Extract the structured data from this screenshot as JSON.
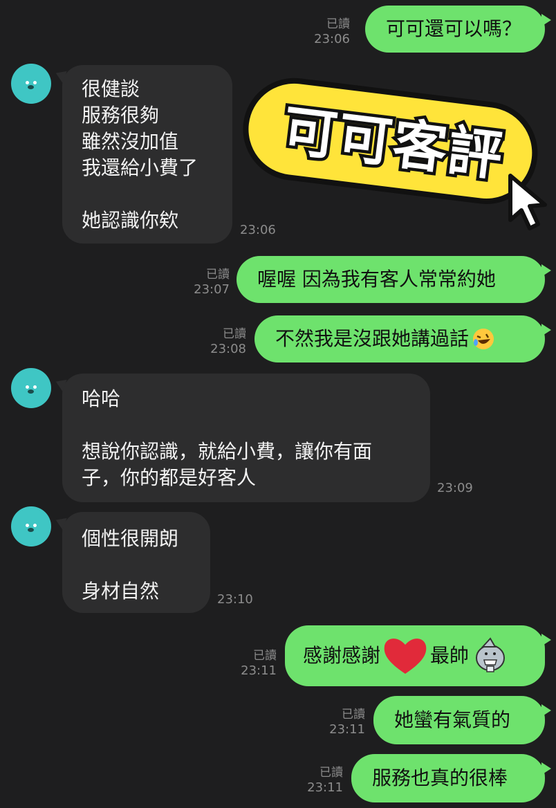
{
  "messages": {
    "m1": {
      "text": "可可還可以嗎？",
      "read": "已讀",
      "time": "23:06"
    },
    "m2": {
      "lines": [
        "很健談",
        "服務很夠",
        "雖然沒加值",
        "我還給小費了",
        "",
        "她認識你欸"
      ],
      "time": "23:06"
    },
    "m3": {
      "text": "喔喔 因為我有客人常常約她",
      "read": "已讀",
      "time": "23:07"
    },
    "m4": {
      "text": "不然我是沒跟她講過話",
      "emoji": "rofl-emoji",
      "read": "已讀",
      "time": "23:08"
    },
    "m5": {
      "lines": [
        "哈哈",
        "",
        "想說你認識，就給小費，讓你有面",
        "子，你的都是好客人"
      ],
      "time": "23:09"
    },
    "m6": {
      "lines": [
        "個性很開朗",
        "",
        "身材自然"
      ],
      "time": "23:10"
    },
    "m7": {
      "text_a": "感謝感謝",
      "text_b": "最帥",
      "read": "已讀",
      "time": "23:11"
    },
    "m8": {
      "text": "她蠻有氣質的",
      "read": "已讀",
      "time": "23:11"
    },
    "m9": {
      "text": "服務也真的很棒",
      "read": "已讀",
      "time": "23:11"
    }
  },
  "overlay": {
    "title": "可可客評"
  },
  "icons": {
    "avatar": "seal-avatar-icon",
    "cursor": "cursor-arrow-icon",
    "heart": "heart-icon",
    "sticker": "shark-sticker-icon"
  },
  "colors": {
    "background": "#1e1e1f",
    "outgoing": "#6ee26d",
    "incoming": "#2d2d2e",
    "banner": "#ffe43a"
  }
}
